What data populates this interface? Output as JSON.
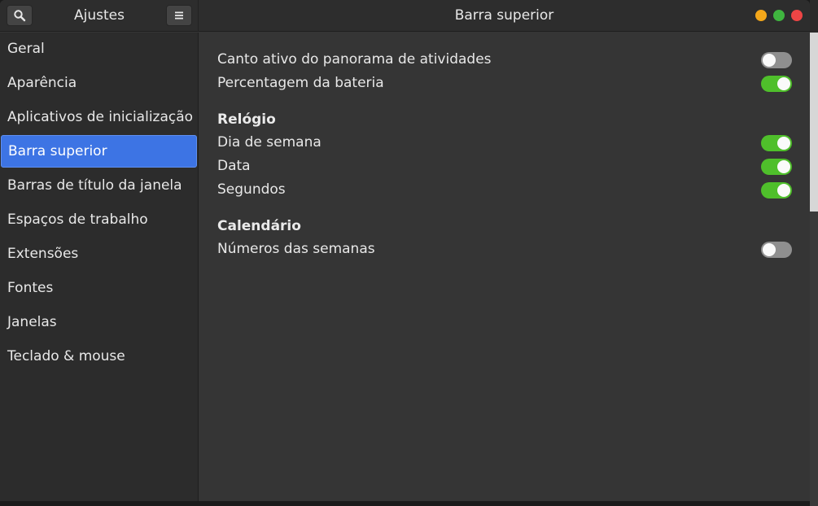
{
  "header": {
    "left_title": "Ajustes",
    "title": "Barra superior"
  },
  "icons": {
    "search": "search-icon",
    "menu": "hamburger-menu-icon"
  },
  "colors": {
    "accent": "#3d74e4",
    "switch_on": "#4fbf2b",
    "minimize": "#f4a71a",
    "maximize": "#3fb53f",
    "close": "#ee4545"
  },
  "sidebar": {
    "items": [
      {
        "label": "Geral"
      },
      {
        "label": "Aparência"
      },
      {
        "label": "Aplicativos de inicialização"
      },
      {
        "label": "Barra superior"
      },
      {
        "label": "Barras de título da janela"
      },
      {
        "label": "Espaços de trabalho"
      },
      {
        "label": "Extensões"
      },
      {
        "label": "Fontes"
      },
      {
        "label": "Janelas"
      },
      {
        "label": "Teclado & mouse"
      }
    ],
    "selected": "Barra superior"
  },
  "main": {
    "settings": [
      {
        "label": "Canto ativo do panorama de atividades",
        "enabled": false
      },
      {
        "label": "Percentagem da bateria",
        "enabled": true
      }
    ],
    "clock": {
      "title": "Relógio",
      "settings": [
        {
          "label": "Dia de semana",
          "enabled": true
        },
        {
          "label": "Data",
          "enabled": true
        },
        {
          "label": "Segundos",
          "enabled": true
        }
      ]
    },
    "calendar": {
      "title": "Calendário",
      "settings": [
        {
          "label": "Números das semanas",
          "enabled": false
        }
      ]
    }
  }
}
